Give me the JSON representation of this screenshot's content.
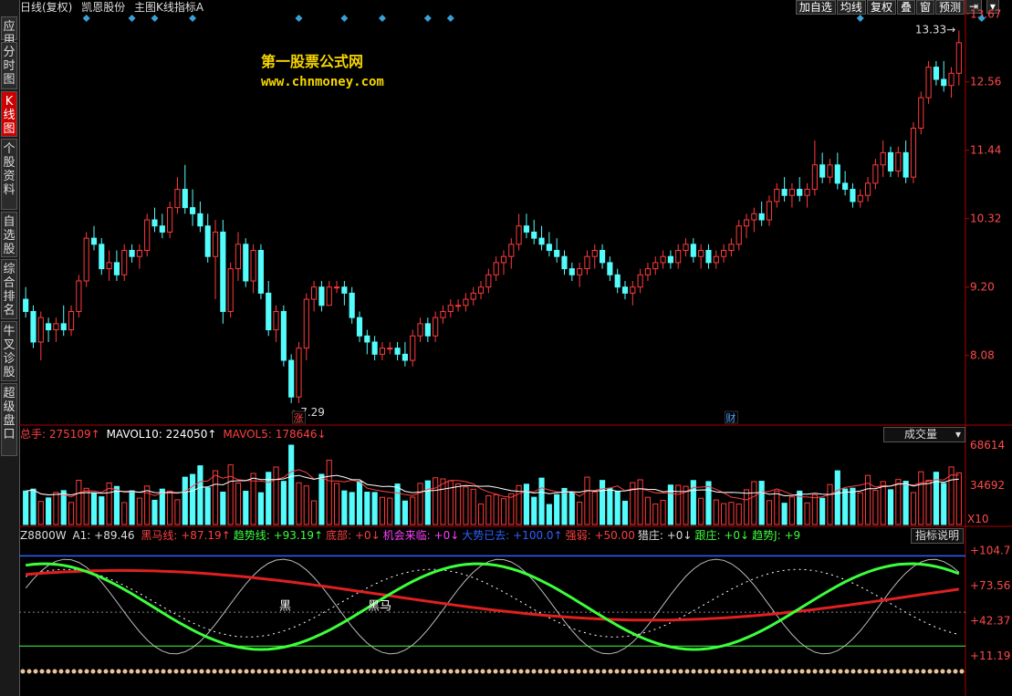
{
  "header": {
    "period": "日线(复权)",
    "stock_name": "凯恩股份",
    "indicator": "主图K线指标A"
  },
  "toolbar": {
    "buttons": [
      "加自选",
      "均线",
      "复权",
      "叠",
      "窗",
      "预测"
    ],
    "right_arrow": "⇥",
    "more": "▾"
  },
  "sidebar": {
    "tabs": [
      "应用",
      "分时图",
      "K线图",
      "个股资料",
      "自选股",
      "综合排名",
      "牛叉诊股",
      "超级盘口"
    ],
    "active": 2
  },
  "watermark": {
    "line1": "第一股票公式网",
    "line2": "www.chnmoney.com"
  },
  "main_chart": {
    "y_ticks": [
      "13.67",
      "12.56",
      "11.44",
      "10.32",
      "9.20",
      "8.08"
    ],
    "high_label": "13.33",
    "low_label": "7.29",
    "markers": [
      {
        "text": "涨",
        "color": "#ff4040"
      },
      {
        "text": "财",
        "color": "#4da3ff"
      }
    ],
    "colors": {
      "up": "#ff3b3b",
      "down": "#54fcfc",
      "axis": "#b00000"
    }
  },
  "volume_panel": {
    "total_label": "总手: 275109↑",
    "mavol10_label": "MAVOL10: 224050↑",
    "mavol5_label": "MAVOL5: 178646↓",
    "dropdown": "成交量",
    "y_ticks": [
      "68614",
      "34692"
    ],
    "unit": "X10"
  },
  "indicator_panel": {
    "name": "Z8800W",
    "a1": "A1: +89.46",
    "items": [
      {
        "text": "黑马线: +87.19↑",
        "color": "#ff4040"
      },
      {
        "text": "趋势线: +93.19↑",
        "color": "#3cff3c"
      },
      {
        "text": "底部: +0↓",
        "color": "#ff4040"
      },
      {
        "text": "机会来临: +0↓",
        "color": "#ff40ff"
      },
      {
        "text": "大势已去: +100.0↑",
        "color": "#3060ff"
      },
      {
        "text": "强弱: +50.00",
        "color": "#ff4040"
      },
      {
        "text": "猎庄: +0↓",
        "color": "#dddddd"
      },
      {
        "text": "跟庄: +0↓",
        "color": "#3cff3c"
      },
      {
        "text": "趋势J: +9",
        "color": "#3cff3c"
      }
    ],
    "button": "指标说明",
    "y_ticks": [
      "+104.7",
      "+73.56",
      "+42.37",
      "+11.19"
    ],
    "tags": [
      "黑",
      "黑马"
    ]
  },
  "chart_data": [
    {
      "type": "candlestick",
      "title": "凯恩股份 日线(复权)",
      "ylim": [
        7.0,
        13.75
      ],
      "y_ticks": [
        13.67,
        12.56,
        11.44,
        10.32,
        9.2,
        8.08
      ],
      "ohlc": [
        [
          9.0,
          9.2,
          8.7,
          8.8
        ],
        [
          8.8,
          8.9,
          8.2,
          8.3
        ],
        [
          8.3,
          8.8,
          8.0,
          8.7
        ],
        [
          8.6,
          8.7,
          8.3,
          8.5
        ],
        [
          8.5,
          8.7,
          8.3,
          8.6
        ],
        [
          8.6,
          8.9,
          8.4,
          8.5
        ],
        [
          8.5,
          8.9,
          8.4,
          8.8
        ],
        [
          8.8,
          9.4,
          8.7,
          9.3
        ],
        [
          9.3,
          10.1,
          9.2,
          10.0
        ],
        [
          10.0,
          10.2,
          9.8,
          9.9
        ],
        [
          9.9,
          10.0,
          9.4,
          9.5
        ],
        [
          9.5,
          9.8,
          9.3,
          9.6
        ],
        [
          9.6,
          9.8,
          9.3,
          9.4
        ],
        [
          9.4,
          9.9,
          9.3,
          9.8
        ],
        [
          9.8,
          9.9,
          9.6,
          9.7
        ],
        [
          9.7,
          9.9,
          9.5,
          9.8
        ],
        [
          9.8,
          10.4,
          9.7,
          10.3
        ],
        [
          10.3,
          10.5,
          10.1,
          10.2
        ],
        [
          10.2,
          10.4,
          10.0,
          10.1
        ],
        [
          10.1,
          10.6,
          10.0,
          10.5
        ],
        [
          10.5,
          11.0,
          10.4,
          10.8
        ],
        [
          10.8,
          11.2,
          10.4,
          10.5
        ],
        [
          10.5,
          10.8,
          10.2,
          10.4
        ],
        [
          10.4,
          10.6,
          10.1,
          10.2
        ],
        [
          10.2,
          10.4,
          9.6,
          9.7
        ],
        [
          9.7,
          10.3,
          9.0,
          10.1
        ],
        [
          10.1,
          10.3,
          8.6,
          8.8
        ],
        [
          8.8,
          9.6,
          8.7,
          9.5
        ],
        [
          9.5,
          10.1,
          9.3,
          9.9
        ],
        [
          9.9,
          10.0,
          9.2,
          9.3
        ],
        [
          9.3,
          9.9,
          9.1,
          9.8
        ],
        [
          9.8,
          9.9,
          9.0,
          9.1
        ],
        [
          9.1,
          9.3,
          8.4,
          8.5
        ],
        [
          8.5,
          8.9,
          8.3,
          8.8
        ],
        [
          8.8,
          8.9,
          7.9,
          8.0
        ],
        [
          8.0,
          8.1,
          7.3,
          7.4
        ],
        [
          7.4,
          8.3,
          7.3,
          8.2
        ],
        [
          8.2,
          9.1,
          8.0,
          9.0
        ],
        [
          9.0,
          9.3,
          8.8,
          9.2
        ],
        [
          9.2,
          9.3,
          8.8,
          8.9
        ],
        [
          8.9,
          9.3,
          8.9,
          9.2
        ],
        [
          9.2,
          9.3,
          9.1,
          9.2
        ],
        [
          9.2,
          9.3,
          8.9,
          9.1
        ],
        [
          9.1,
          9.2,
          8.6,
          8.7
        ],
        [
          8.7,
          8.8,
          8.3,
          8.4
        ],
        [
          8.4,
          8.5,
          8.1,
          8.3
        ],
        [
          8.3,
          8.4,
          8.0,
          8.1
        ],
        [
          8.1,
          8.3,
          8.0,
          8.2
        ],
        [
          8.2,
          8.3,
          8.1,
          8.2
        ],
        [
          8.2,
          8.3,
          8.0,
          8.1
        ],
        [
          8.1,
          8.3,
          7.9,
          8.0
        ],
        [
          8.0,
          8.5,
          7.9,
          8.4
        ],
        [
          8.4,
          8.7,
          8.3,
          8.6
        ],
        [
          8.6,
          8.7,
          8.3,
          8.4
        ],
        [
          8.4,
          8.8,
          8.3,
          8.7
        ],
        [
          8.7,
          8.9,
          8.6,
          8.8
        ],
        [
          8.8,
          9.0,
          8.7,
          8.9
        ],
        [
          8.9,
          9.0,
          8.8,
          8.9
        ],
        [
          8.9,
          9.1,
          8.8,
          9.0
        ],
        [
          9.0,
          9.2,
          8.9,
          9.1
        ],
        [
          9.1,
          9.3,
          9.0,
          9.2
        ],
        [
          9.2,
          9.5,
          9.1,
          9.4
        ],
        [
          9.4,
          9.7,
          9.3,
          9.6
        ],
        [
          9.6,
          9.8,
          9.4,
          9.7
        ],
        [
          9.7,
          10.0,
          9.5,
          9.9
        ],
        [
          9.9,
          10.4,
          9.8,
          10.2
        ],
        [
          10.2,
          10.4,
          10.0,
          10.1
        ],
        [
          10.1,
          10.3,
          9.9,
          10.0
        ],
        [
          10.0,
          10.2,
          9.8,
          9.9
        ],
        [
          9.9,
          10.1,
          9.7,
          9.8
        ],
        [
          9.8,
          10.0,
          9.6,
          9.7
        ],
        [
          9.7,
          9.8,
          9.4,
          9.5
        ],
        [
          9.5,
          9.6,
          9.3,
          9.4
        ],
        [
          9.4,
          9.6,
          9.2,
          9.5
        ],
        [
          9.5,
          9.8,
          9.4,
          9.7
        ],
        [
          9.7,
          9.9,
          9.5,
          9.8
        ],
        [
          9.8,
          9.9,
          9.5,
          9.6
        ],
        [
          9.6,
          9.7,
          9.3,
          9.4
        ],
        [
          9.4,
          9.5,
          9.1,
          9.2
        ],
        [
          9.2,
          9.3,
          9.0,
          9.1
        ],
        [
          9.1,
          9.3,
          8.9,
          9.2
        ],
        [
          9.2,
          9.5,
          9.1,
          9.4
        ],
        [
          9.4,
          9.6,
          9.3,
          9.5
        ],
        [
          9.5,
          9.7,
          9.4,
          9.6
        ],
        [
          9.6,
          9.8,
          9.5,
          9.7
        ],
        [
          9.7,
          9.8,
          9.5,
          9.6
        ],
        [
          9.6,
          9.9,
          9.5,
          9.8
        ],
        [
          9.8,
          10.0,
          9.7,
          9.9
        ],
        [
          9.9,
          10.0,
          9.6,
          9.7
        ],
        [
          9.7,
          9.9,
          9.5,
          9.8
        ],
        [
          9.8,
          9.9,
          9.5,
          9.6
        ],
        [
          9.6,
          9.8,
          9.5,
          9.7
        ],
        [
          9.7,
          9.9,
          9.6,
          9.8
        ],
        [
          9.8,
          10.0,
          9.7,
          9.9
        ],
        [
          9.9,
          10.3,
          9.8,
          10.2
        ],
        [
          10.2,
          10.4,
          10.0,
          10.3
        ],
        [
          10.3,
          10.5,
          10.1,
          10.4
        ],
        [
          10.4,
          10.6,
          10.2,
          10.3
        ],
        [
          10.3,
          10.7,
          10.2,
          10.6
        ],
        [
          10.6,
          10.9,
          10.5,
          10.8
        ],
        [
          10.8,
          11.0,
          10.6,
          10.7
        ],
        [
          10.7,
          10.9,
          10.5,
          10.8
        ],
        [
          10.8,
          11.0,
          10.6,
          10.7
        ],
        [
          10.7,
          10.9,
          10.5,
          10.8
        ],
        [
          10.8,
          11.6,
          10.7,
          11.2
        ],
        [
          11.2,
          11.4,
          10.9,
          11.0
        ],
        [
          11.0,
          11.3,
          10.9,
          11.2
        ],
        [
          11.2,
          11.4,
          10.8,
          10.9
        ],
        [
          10.9,
          11.1,
          10.7,
          10.8
        ],
        [
          10.8,
          10.9,
          10.5,
          10.6
        ],
        [
          10.6,
          10.8,
          10.5,
          10.7
        ],
        [
          10.7,
          11.0,
          10.6,
          10.9
        ],
        [
          10.9,
          11.3,
          10.8,
          11.2
        ],
        [
          11.2,
          11.6,
          11.0,
          11.4
        ],
        [
          11.4,
          11.5,
          11.0,
          11.1
        ],
        [
          11.1,
          11.5,
          11.0,
          11.4
        ],
        [
          11.4,
          11.6,
          10.9,
          11.0
        ],
        [
          11.0,
          11.9,
          10.9,
          11.8
        ],
        [
          11.8,
          12.4,
          11.7,
          12.3
        ],
        [
          12.3,
          12.9,
          12.2,
          12.8
        ],
        [
          12.8,
          12.9,
          12.5,
          12.6
        ],
        [
          12.6,
          12.9,
          12.4,
          12.5
        ],
        [
          12.5,
          12.8,
          12.3,
          12.7
        ],
        [
          12.7,
          13.4,
          12.5,
          13.2
        ]
      ],
      "events": [
        "涨",
        "财"
      ],
      "annotations": {
        "high": "13.33",
        "low": "7.29"
      }
    },
    {
      "type": "bar",
      "title": "成交量",
      "ylim": [
        0,
        80000
      ],
      "y_ticks": [
        68614,
        34692
      ],
      "series": [
        {
          "name": "MAVOL10",
          "values": [
            224050
          ]
        },
        {
          "name": "MAVOL5",
          "values": [
            178646
          ]
        },
        {
          "name": "总手",
          "values": [
            275109
          ]
        }
      ]
    },
    {
      "type": "line",
      "title": "Z8800W",
      "ylim": [
        0,
        110
      ],
      "y_ticks": [
        104.7,
        73.56,
        42.37,
        11.19
      ],
      "series": [
        {
          "name": "黑马线",
          "values": [
            87.19
          ]
        },
        {
          "name": "趋势线",
          "values": [
            93.19
          ]
        },
        {
          "name": "大势已去",
          "values": [
            100.0
          ]
        },
        {
          "name": "强弱",
          "values": [
            50.0
          ]
        }
      ]
    }
  ]
}
